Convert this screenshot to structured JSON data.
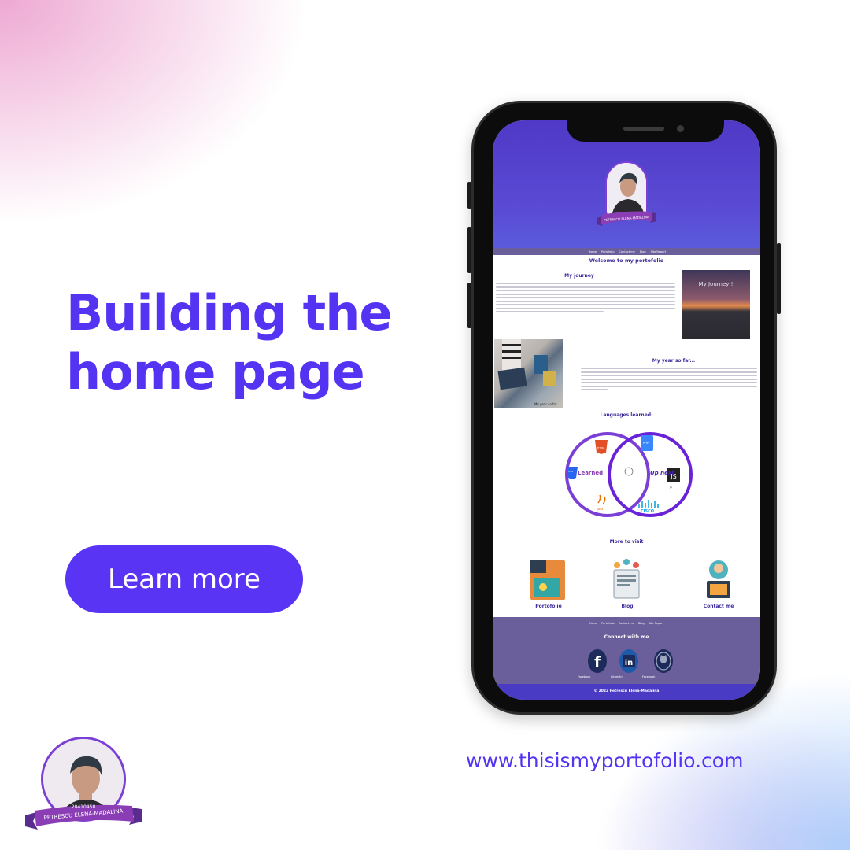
{
  "promo": {
    "headline_line1": "Building the",
    "headline_line2": "home page",
    "cta_label": "Learn more",
    "url": "www.thisismyportofolio.com"
  },
  "badge": {
    "id": "20410458",
    "name": "PETRESCU ELENA-MADALINA"
  },
  "site": {
    "nav": [
      "Home",
      "Portofolio",
      "Contact me",
      "Blog",
      "Site Report"
    ],
    "welcome": "Welcome to my portofolio",
    "journey_title": "My journey",
    "journey_image_caption": "My Journey !",
    "year_title": "My year so far...",
    "year_image_caption": "My year so far...",
    "languages_title": "Languages learned:",
    "venn_left": "Learned",
    "venn_right": "Up next",
    "venn_left_items": [
      "HTML",
      "CSS",
      "Java"
    ],
    "venn_right_items": [
      "PHP",
      "JS",
      "CISCO"
    ],
    "more_title": "More to visit",
    "visit_items": [
      "Portofolio",
      "Blog",
      "Contact me"
    ],
    "footer_nav": [
      "Home",
      "Portofolio",
      "Contact me",
      "Blog",
      "Site Report"
    ],
    "connect_title": "Connect with me",
    "social": [
      "Facebook",
      "LinkedIn",
      "Facebook"
    ],
    "copyright": "© 2022 Petrescu Elena-Madalina"
  },
  "colors": {
    "accent": "#5433f2",
    "button": "#5a34f5",
    "site_header": "#4f39c6",
    "site_footer": "#6a5f9a",
    "venn_purple": "#7b3fd6"
  }
}
